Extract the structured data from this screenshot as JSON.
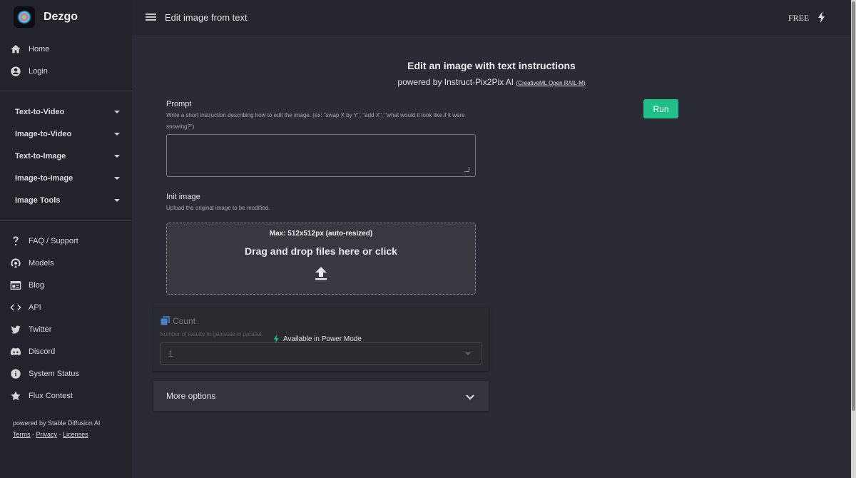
{
  "brand": {
    "name": "Dezgo"
  },
  "topbar": {
    "title": "Edit image from text",
    "plan": "FREE"
  },
  "sidebar": {
    "primary": [
      {
        "label": "Home",
        "icon": "home-icon"
      },
      {
        "label": "Login",
        "icon": "account-icon"
      }
    ],
    "categories": [
      {
        "label": "Text-to-Video"
      },
      {
        "label": "Image-to-Video"
      },
      {
        "label": "Text-to-Image"
      },
      {
        "label": "Image-to-Image"
      },
      {
        "label": "Image Tools"
      }
    ],
    "secondary": [
      {
        "label": "FAQ / Support",
        "icon": "question-icon"
      },
      {
        "label": "Models",
        "icon": "models-icon"
      },
      {
        "label": "Blog",
        "icon": "blog-icon"
      },
      {
        "label": "API",
        "icon": "code-icon"
      },
      {
        "label": "Twitter",
        "icon": "twitter-icon"
      },
      {
        "label": "Discord",
        "icon": "discord-icon"
      },
      {
        "label": "System Status",
        "icon": "info-icon"
      },
      {
        "label": "Flux Contest",
        "icon": "star-icon"
      }
    ],
    "footer": {
      "powered": "powered by Stable Diffusion AI",
      "terms": "Terms",
      "privacy": "Privacy",
      "licenses": "Licenses",
      "sep": "-"
    }
  },
  "main": {
    "heading": "Edit an image with text instructions",
    "powered_by": "powered by Instruct-Pix2Pix AI",
    "license_open": "(",
    "license": "CreativeML Open RAIL-M",
    "license_close": ")",
    "prompt": {
      "label": "Prompt",
      "hint": "Write a short instruction describing how to edit the image. (ex: \"swap X by Y\", \"add X\", \"what would it look like if it were snowing?\")",
      "value": ""
    },
    "run_label": "Run",
    "init_image": {
      "label": "Init image",
      "hint": "Upload the original image to be modified.",
      "max": "Max: 512x512px (auto-resized)",
      "drop": "Drag and drop files here or click"
    },
    "count": {
      "label": "Count",
      "hint": "Number of results to generate in parallel",
      "value": "1",
      "power_mode": "Available in Power Mode"
    },
    "more_options": "More options"
  },
  "colors": {
    "accent": "#1fbf85",
    "sidebar_bg": "#23232b",
    "main_bg": "#2b2b35"
  }
}
